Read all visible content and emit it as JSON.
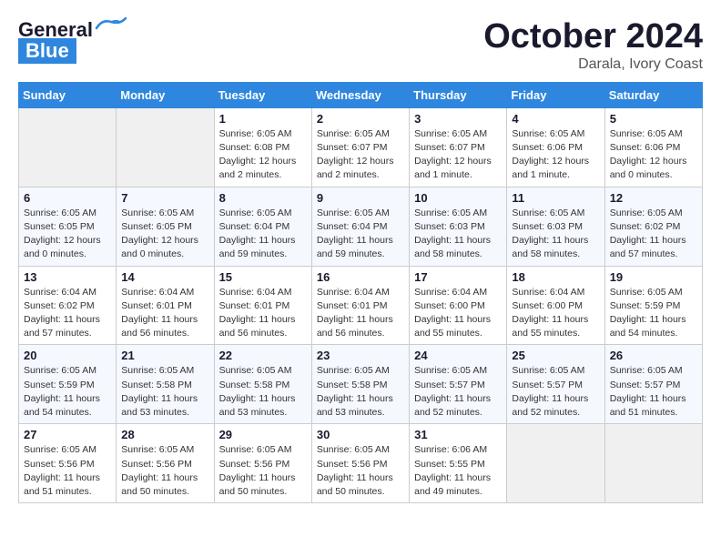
{
  "header": {
    "logo_general": "General",
    "logo_blue": "Blue",
    "month": "October 2024",
    "location": "Darala, Ivory Coast"
  },
  "weekdays": [
    "Sunday",
    "Monday",
    "Tuesday",
    "Wednesday",
    "Thursday",
    "Friday",
    "Saturday"
  ],
  "weeks": [
    [
      {
        "day": "",
        "info": ""
      },
      {
        "day": "",
        "info": ""
      },
      {
        "day": "1",
        "info": "Sunrise: 6:05 AM\nSunset: 6:08 PM\nDaylight: 12 hours\nand 2 minutes."
      },
      {
        "day": "2",
        "info": "Sunrise: 6:05 AM\nSunset: 6:07 PM\nDaylight: 12 hours\nand 2 minutes."
      },
      {
        "day": "3",
        "info": "Sunrise: 6:05 AM\nSunset: 6:07 PM\nDaylight: 12 hours\nand 1 minute."
      },
      {
        "day": "4",
        "info": "Sunrise: 6:05 AM\nSunset: 6:06 PM\nDaylight: 12 hours\nand 1 minute."
      },
      {
        "day": "5",
        "info": "Sunrise: 6:05 AM\nSunset: 6:06 PM\nDaylight: 12 hours\nand 0 minutes."
      }
    ],
    [
      {
        "day": "6",
        "info": "Sunrise: 6:05 AM\nSunset: 6:05 PM\nDaylight: 12 hours\nand 0 minutes."
      },
      {
        "day": "7",
        "info": "Sunrise: 6:05 AM\nSunset: 6:05 PM\nDaylight: 12 hours\nand 0 minutes."
      },
      {
        "day": "8",
        "info": "Sunrise: 6:05 AM\nSunset: 6:04 PM\nDaylight: 11 hours\nand 59 minutes."
      },
      {
        "day": "9",
        "info": "Sunrise: 6:05 AM\nSunset: 6:04 PM\nDaylight: 11 hours\nand 59 minutes."
      },
      {
        "day": "10",
        "info": "Sunrise: 6:05 AM\nSunset: 6:03 PM\nDaylight: 11 hours\nand 58 minutes."
      },
      {
        "day": "11",
        "info": "Sunrise: 6:05 AM\nSunset: 6:03 PM\nDaylight: 11 hours\nand 58 minutes."
      },
      {
        "day": "12",
        "info": "Sunrise: 6:05 AM\nSunset: 6:02 PM\nDaylight: 11 hours\nand 57 minutes."
      }
    ],
    [
      {
        "day": "13",
        "info": "Sunrise: 6:04 AM\nSunset: 6:02 PM\nDaylight: 11 hours\nand 57 minutes."
      },
      {
        "day": "14",
        "info": "Sunrise: 6:04 AM\nSunset: 6:01 PM\nDaylight: 11 hours\nand 56 minutes."
      },
      {
        "day": "15",
        "info": "Sunrise: 6:04 AM\nSunset: 6:01 PM\nDaylight: 11 hours\nand 56 minutes."
      },
      {
        "day": "16",
        "info": "Sunrise: 6:04 AM\nSunset: 6:01 PM\nDaylight: 11 hours\nand 56 minutes."
      },
      {
        "day": "17",
        "info": "Sunrise: 6:04 AM\nSunset: 6:00 PM\nDaylight: 11 hours\nand 55 minutes."
      },
      {
        "day": "18",
        "info": "Sunrise: 6:04 AM\nSunset: 6:00 PM\nDaylight: 11 hours\nand 55 minutes."
      },
      {
        "day": "19",
        "info": "Sunrise: 6:05 AM\nSunset: 5:59 PM\nDaylight: 11 hours\nand 54 minutes."
      }
    ],
    [
      {
        "day": "20",
        "info": "Sunrise: 6:05 AM\nSunset: 5:59 PM\nDaylight: 11 hours\nand 54 minutes."
      },
      {
        "day": "21",
        "info": "Sunrise: 6:05 AM\nSunset: 5:58 PM\nDaylight: 11 hours\nand 53 minutes."
      },
      {
        "day": "22",
        "info": "Sunrise: 6:05 AM\nSunset: 5:58 PM\nDaylight: 11 hours\nand 53 minutes."
      },
      {
        "day": "23",
        "info": "Sunrise: 6:05 AM\nSunset: 5:58 PM\nDaylight: 11 hours\nand 53 minutes."
      },
      {
        "day": "24",
        "info": "Sunrise: 6:05 AM\nSunset: 5:57 PM\nDaylight: 11 hours\nand 52 minutes."
      },
      {
        "day": "25",
        "info": "Sunrise: 6:05 AM\nSunset: 5:57 PM\nDaylight: 11 hours\nand 52 minutes."
      },
      {
        "day": "26",
        "info": "Sunrise: 6:05 AM\nSunset: 5:57 PM\nDaylight: 11 hours\nand 51 minutes."
      }
    ],
    [
      {
        "day": "27",
        "info": "Sunrise: 6:05 AM\nSunset: 5:56 PM\nDaylight: 11 hours\nand 51 minutes."
      },
      {
        "day": "28",
        "info": "Sunrise: 6:05 AM\nSunset: 5:56 PM\nDaylight: 11 hours\nand 50 minutes."
      },
      {
        "day": "29",
        "info": "Sunrise: 6:05 AM\nSunset: 5:56 PM\nDaylight: 11 hours\nand 50 minutes."
      },
      {
        "day": "30",
        "info": "Sunrise: 6:05 AM\nSunset: 5:56 PM\nDaylight: 11 hours\nand 50 minutes."
      },
      {
        "day": "31",
        "info": "Sunrise: 6:06 AM\nSunset: 5:55 PM\nDaylight: 11 hours\nand 49 minutes."
      },
      {
        "day": "",
        "info": ""
      },
      {
        "day": "",
        "info": ""
      }
    ]
  ]
}
